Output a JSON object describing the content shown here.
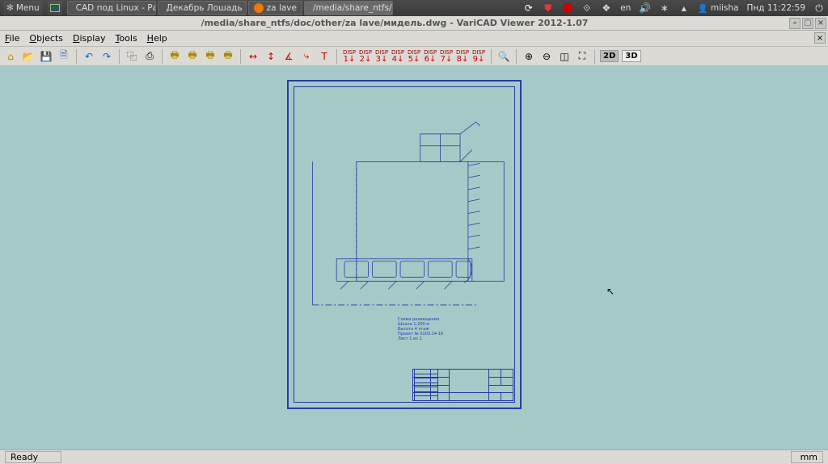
{
  "os_panel": {
    "menu_label": "Menu",
    "task_buttons": [
      {
        "label": "CAD под Linux - Ра…",
        "icon": "opera"
      },
      {
        "label": "Декабрь Лошадь …",
        "icon": "firefox"
      },
      {
        "label": "za lave",
        "icon": "firefox"
      },
      {
        "label": "/media/share_ntfs/…",
        "icon": "terminal",
        "active": true
      }
    ],
    "lang": "en",
    "user": "miisha",
    "clock": "Пнд 11:22:59"
  },
  "window": {
    "title": "/media/share_ntfs/doc/other/za lave/мидель.dwg - VariCAD Viewer 2012-1.07"
  },
  "menubar": {
    "items": [
      {
        "label": "File",
        "ul": 0
      },
      {
        "label": "Objects",
        "ul": 0
      },
      {
        "label": "Display",
        "ul": 0
      },
      {
        "label": "Tools",
        "ul": 0
      },
      {
        "label": "Help",
        "ul": 0
      }
    ]
  },
  "toolbar": {
    "disp_n": [
      "1",
      "2",
      "3",
      "4",
      "5",
      "6",
      "7",
      "8",
      "9"
    ],
    "view2d": "2D",
    "view3d": "3D"
  },
  "drawing": {
    "notes": "Схема размещения\nШкала 1:200 м\nВысота 4 этаж\nПроект № 0103.14-16\nЛист 1 из 1"
  },
  "status": {
    "left": "Ready",
    "right": "mm"
  }
}
